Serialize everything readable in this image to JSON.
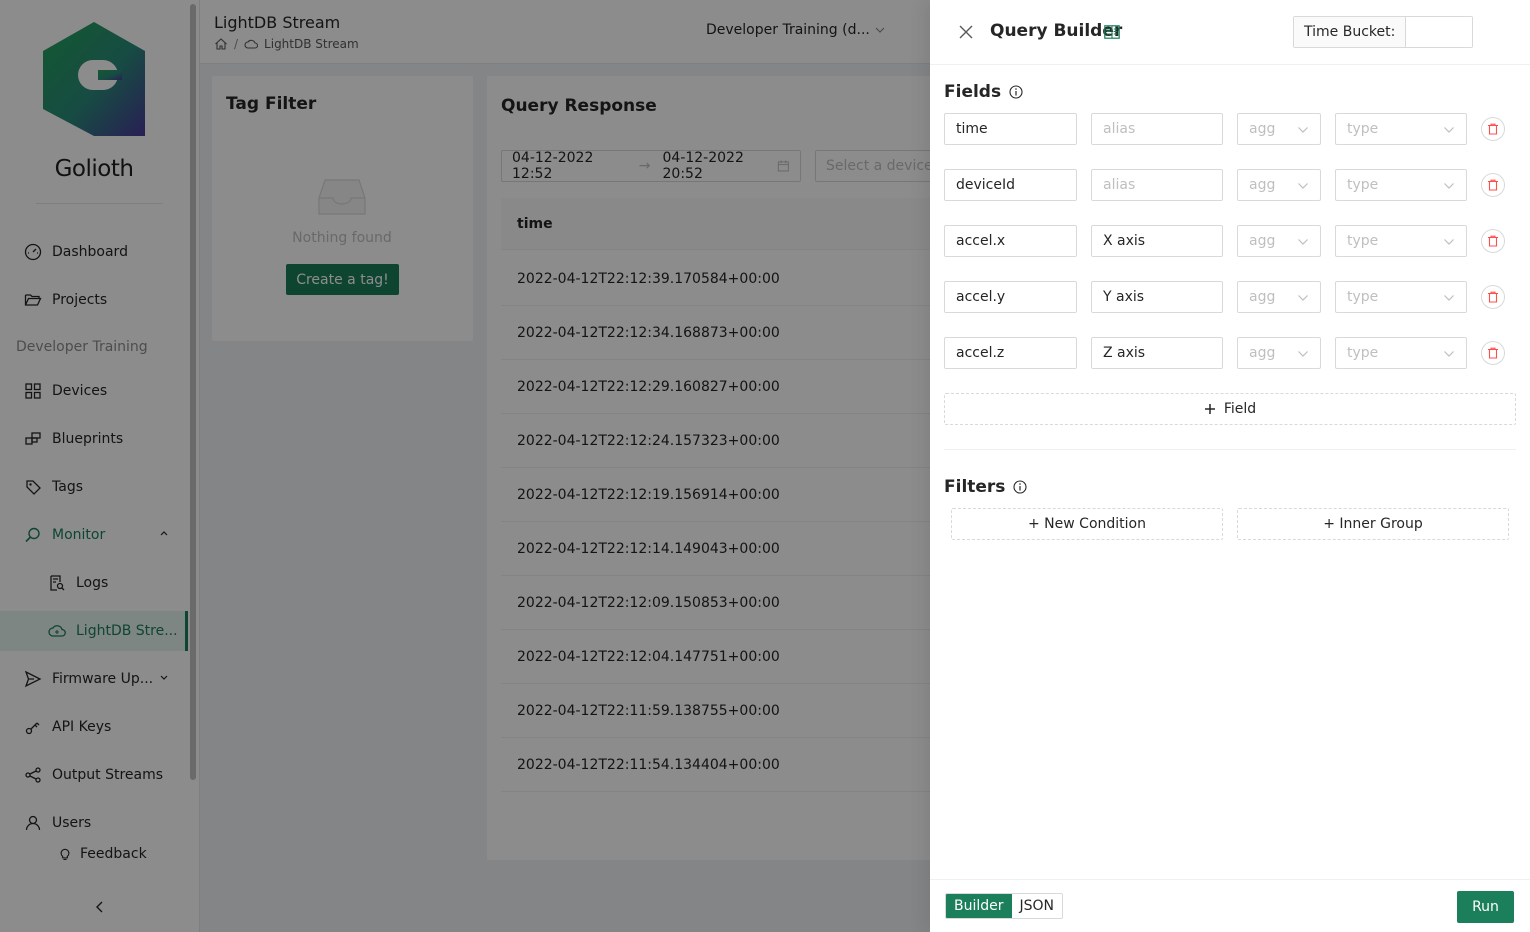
{
  "sidebar": {
    "brand": "Golioth",
    "section_label": "Developer Training",
    "items": [
      {
        "label": "Dashboard"
      },
      {
        "label": "Projects"
      },
      {
        "label": "Devices"
      },
      {
        "label": "Blueprints"
      },
      {
        "label": "Tags"
      },
      {
        "label": "Monitor"
      },
      {
        "label": "Logs"
      },
      {
        "label": "LightDB Stre..."
      },
      {
        "label": "Firmware Up..."
      },
      {
        "label": "API Keys"
      },
      {
        "label": "Output Streams"
      },
      {
        "label": "Users"
      },
      {
        "label": "Feedback"
      }
    ]
  },
  "header": {
    "title": "LightDB Stream",
    "breadcrumb_current": "LightDB Stream",
    "breadcrumb_sep": "/",
    "project": "Developer Training (d..."
  },
  "tag_filter": {
    "title": "Tag Filter",
    "empty_text": "Nothing found",
    "create_button": "Create a tag!"
  },
  "query_response": {
    "title": "Query Response",
    "range_start": "04-12-2022 12:52",
    "range_end": "04-12-2022 20:52",
    "device_placeholder": "Select a device",
    "column_header": "time",
    "rows": [
      "2022-04-12T22:12:39.170584+00:00",
      "2022-04-12T22:12:34.168873+00:00",
      "2022-04-12T22:12:29.160827+00:00",
      "2022-04-12T22:12:24.157323+00:00",
      "2022-04-12T22:12:19.156914+00:00",
      "2022-04-12T22:12:14.149043+00:00",
      "2022-04-12T22:12:09.150853+00:00",
      "2022-04-12T22:12:04.147751+00:00",
      "2022-04-12T22:11:59.138755+00:00",
      "2022-04-12T22:11:54.134404+00:00"
    ]
  },
  "query_builder": {
    "title": "Query Builder",
    "time_bucket_label": "Time Bucket:",
    "time_bucket_value": "",
    "fields_title": "Fields",
    "filters_title": "Filters",
    "alias_placeholder": "alias",
    "agg_placeholder": "agg",
    "type_placeholder": "type",
    "fields": [
      {
        "name": "time",
        "alias": ""
      },
      {
        "name": "deviceId",
        "alias": ""
      },
      {
        "name": "accel.x",
        "alias": "X axis"
      },
      {
        "name": "accel.y",
        "alias": "Y axis"
      },
      {
        "name": "accel.z",
        "alias": "Z axis"
      }
    ],
    "add_field_label": "Field",
    "new_condition_label": "+ New Condition",
    "inner_group_label": "+ Inner Group",
    "mode_builder": "Builder",
    "mode_json": "JSON",
    "run_label": "Run"
  },
  "colors": {
    "brand_green": "#1a7f5a",
    "danger": "#ff4d4f",
    "overlay": "rgba(0,0,0,0.45)"
  }
}
